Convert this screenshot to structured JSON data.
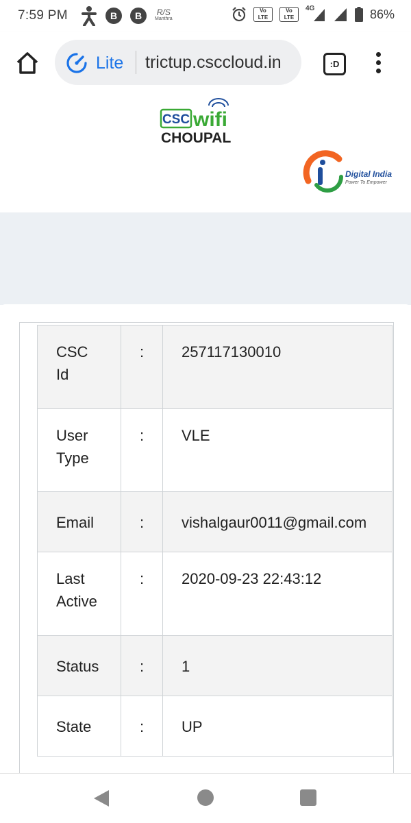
{
  "status_bar": {
    "time": "7:59 PM",
    "rs_label": "R/S",
    "rs_sub": "Manthra",
    "b1": "B",
    "b2": "B",
    "lte1": "Vo LTE",
    "lte2": "Vo LTE",
    "network": "4G",
    "battery": "86%"
  },
  "browser": {
    "lite_label": "Lite",
    "url": "trictup.csccloud.in",
    "tab_label": ":D",
    "icons": [
      "home-icon",
      "lite-speed-icon",
      "tab-switcher-icon",
      "overflow-menu-icon"
    ]
  },
  "header": {
    "logo_csc": "CSC",
    "logo_wifi": "wifi",
    "logo_choupal": "CHOUPAL",
    "di_title": "Digital India",
    "di_tagline": "Power To Empower"
  },
  "profile": {
    "rows": [
      {
        "key_line1": "CSC",
        "key_line2": "Id",
        "sep": ":",
        "value": "257117130010"
      },
      {
        "key_line1": "User",
        "key_line2": "Type",
        "sep": ":",
        "value": "VLE"
      },
      {
        "key_line1": "Email",
        "key_line2": "",
        "sep": ":",
        "value": "vishalgaur0011@gmail.com"
      },
      {
        "key_line1": "Last",
        "key_line2": "Active",
        "sep": ":",
        "value": "2020-09-23 22:43:12"
      },
      {
        "key_line1": "Status",
        "key_line2": "",
        "sep": ":",
        "value": "1"
      },
      {
        "key_line1": "State",
        "key_line2": "",
        "sep": ":",
        "value": "UP"
      }
    ]
  },
  "colors": {
    "accent_blue": "#1a73e8",
    "csc_green": "#3aa935",
    "csc_blue": "#1f4e9c",
    "di_orange": "#f26522",
    "di_green": "#2e9e44",
    "band_gray": "#ecf0f4"
  }
}
